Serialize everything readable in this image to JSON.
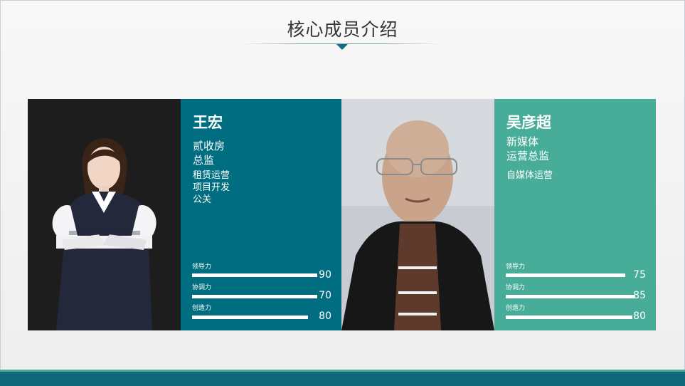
{
  "page": {
    "title": "核心成员介绍",
    "accent_dark": "#006e80",
    "accent_green": "#47ad99"
  },
  "members": [
    {
      "name": "王宏",
      "title_lines": [
        "贰收房",
        "总监"
      ],
      "responsibilities": [
        "租赁运营",
        "项目开发",
        "公关"
      ],
      "skills": [
        {
          "label": "领导力",
          "score": "90",
          "value": 0.9
        },
        {
          "label": "协调力",
          "score": "70",
          "value": 0.7
        },
        {
          "label": "创造力",
          "score": "80",
          "value": 0.8
        }
      ]
    },
    {
      "name": "吴彦超",
      "title_lines": [
        "新媒体",
        "运营总监"
      ],
      "responsibilities": [
        "自媒体运营"
      ],
      "skills": [
        {
          "label": "领导力",
          "score": "75",
          "value": 0.75
        },
        {
          "label": "协调力",
          "score": "85",
          "value": 0.85
        },
        {
          "label": "创造力",
          "score": "80",
          "value": 0.8
        }
      ]
    }
  ]
}
